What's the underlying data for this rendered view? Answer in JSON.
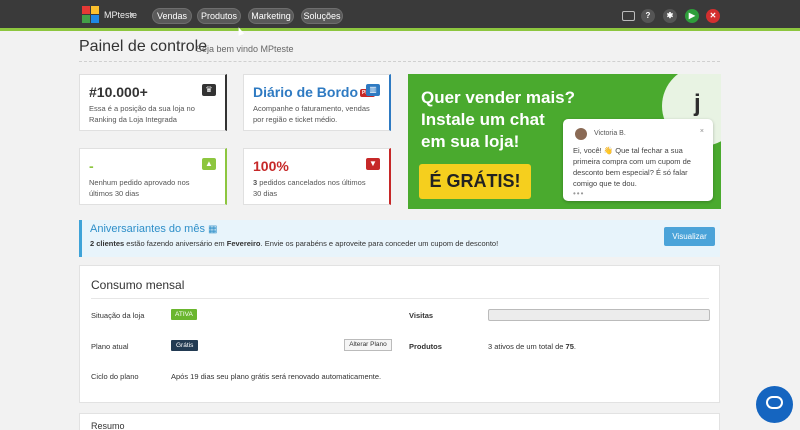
{
  "topbar": {
    "brand": "MPteste",
    "nav": [
      "Vendas",
      "Produtos",
      "Marketing",
      "Soluções"
    ],
    "icons": [
      "monitor-icon",
      "help-icon",
      "gear-icon",
      "play-icon",
      "close-icon"
    ],
    "colors": {
      "bar": "#3a3a3a",
      "accent": "#8dc63f",
      "help": "#555555",
      "gear": "#555555",
      "play": "#2e9e3a",
      "close": "#d32f2f"
    }
  },
  "header": {
    "title": "Painel de controle",
    "subtitle": "Seja bem vindo MPteste"
  },
  "cards": [
    {
      "big": "#10.000+",
      "text": "Essa é a posição da sua loja no Ranking da Loja Integrada",
      "icon": "trophy-icon",
      "color": "#333333"
    },
    {
      "big": "Diário de Bordo",
      "badge": "PRO",
      "text": "Acompanhe o faturamento, vendas por região e ticket médio.",
      "icon": "chart-icon",
      "color": "#2e7ac2"
    },
    {
      "big": "-",
      "text": "Nenhum pedido aprovado nos últimos 30 dias",
      "icon": "thumbs-up-icon",
      "color": "#8dc63f"
    },
    {
      "big": "100%",
      "text_bold": "3",
      "text": " pedidos cancelados nos últimos 30 dias",
      "icon": "thumbs-down-icon",
      "color": "#c62828"
    }
  ],
  "banner": {
    "line1": "Quer vender mais?",
    "line2": "Instale um chat",
    "line3": "em sua loja!",
    "cta": "É GRÁTIS!",
    "logo_letter": "j",
    "chat_name": "Victoria B.",
    "chat_close": "×",
    "chat_msg": "Ei, você! 👋 Que tal fechar a sua primeira compra com um cupom de desconto bem especial? É só falar comigo que te dou.",
    "chat_dots": "•••"
  },
  "birthday": {
    "title": "Aniversariantes do mês",
    "text_bold_1": "2 clientes",
    "text_1": " estão fazendo aniversário em ",
    "text_bold_2": "Fevereiro",
    "text_2": ". Envie os parabéns e aproveite para conceder um cupom de desconto!",
    "button": "Visualizar"
  },
  "consumo": {
    "title": "Consumo mensal",
    "situacao_label": "Situação da loja",
    "situacao_value": "ATIVA",
    "plano_label": "Plano atual",
    "plano_value": "Grátis",
    "alterar_button": "Alterar Plano",
    "ciclo_label": "Ciclo do plano",
    "ciclo_value": "Após 19 dias seu plano grátis será renovado automaticamente.",
    "visitas_label": "Visitas",
    "visitas_fraction": 0,
    "produtos_label": "Produtos",
    "produtos_text": "3 ativos de um total de ",
    "produtos_total": "75",
    "produtos_suffix": "."
  },
  "resumo": {
    "title": "Resumo"
  }
}
